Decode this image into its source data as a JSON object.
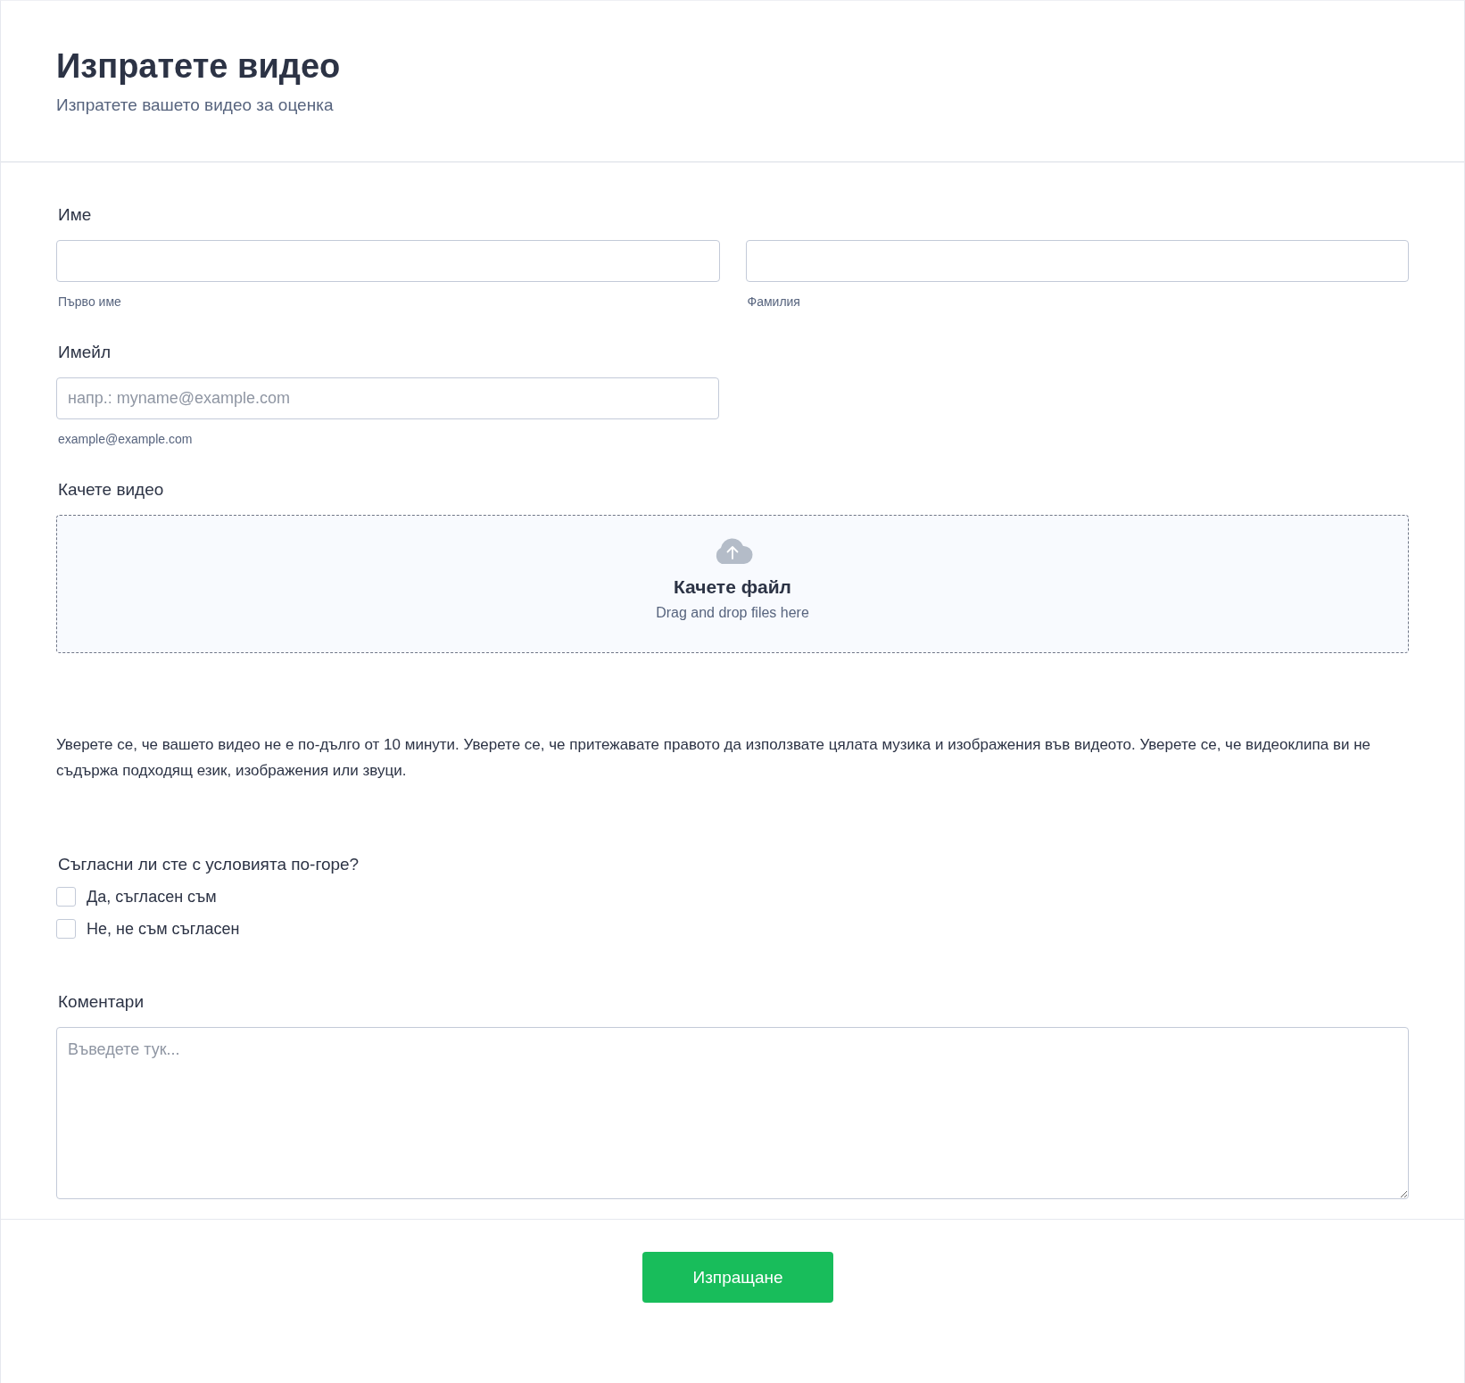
{
  "header": {
    "title": "Изпратете видео",
    "subtitle": "Изпратете вашето видео за оценка"
  },
  "name_field": {
    "label": "Име",
    "parts": [
      {
        "sublabel": "Първо име"
      },
      {
        "sublabel": "Фамилия"
      }
    ]
  },
  "email_field": {
    "label": "Имейл",
    "placeholder": "напр.: myname@example.com",
    "hint": "example@example.com"
  },
  "upload": {
    "label": "Качете видео",
    "title": "Качете файл",
    "subtitle": "Drag and drop files here"
  },
  "notice": "Уверете се, че вашето видео не е по-дълго от 10 минути. Уверете се, че притежавате правото да използвате цялата музика и изображения във видеото. Уверете се, че видеоклипа ви не съдържа подходящ език, изображения или звуци.",
  "agreement": {
    "question": "Съгласни ли сте с условията по-горе?",
    "options": [
      {
        "label": "Да, съгласен съм",
        "checked": false
      },
      {
        "label": "Не, не съм съгласен",
        "checked": false
      }
    ]
  },
  "comments": {
    "label": "Коментари",
    "placeholder": "Въведете тук..."
  },
  "submit": {
    "label": "Изпращане"
  }
}
